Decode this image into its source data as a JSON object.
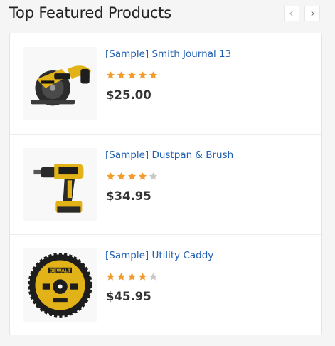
{
  "widget": {
    "title": "Top Featured Products",
    "prev_icon": "chevron-left-icon",
    "next_icon": "chevron-right-icon"
  },
  "colors": {
    "link": "#1f5fb0",
    "star_filled": "#f39c2b",
    "star_empty": "#c8c8c8"
  },
  "products": [
    {
      "name": "[Sample] Smith Journal 13",
      "rating": 5,
      "max_rating": 5,
      "price": "$25.00",
      "image": "circular-saw-image"
    },
    {
      "name": "[Sample] Dustpan & Brush",
      "rating": 4,
      "max_rating": 5,
      "price": "$34.95",
      "image": "cordless-drill-image"
    },
    {
      "name": "[Sample] Utility Caddy",
      "rating": 4,
      "max_rating": 5,
      "price": "$45.95",
      "image": "saw-blade-image"
    }
  ]
}
